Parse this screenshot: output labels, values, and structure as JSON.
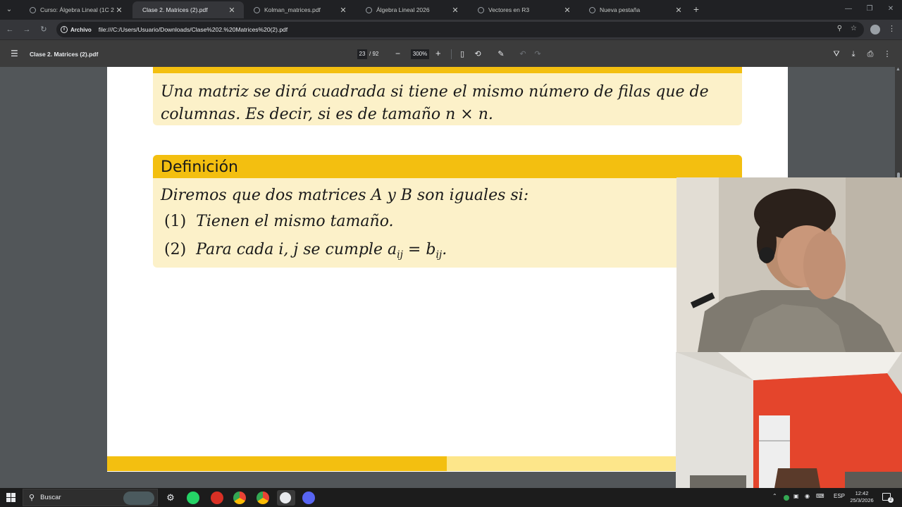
{
  "browser": {
    "tabs": [
      {
        "title": "Curso: Álgebra Lineal (1C 2026)",
        "active": false
      },
      {
        "title": "Clase 2. Matrices (2).pdf",
        "active": true
      },
      {
        "title": "Kolman_matrices.pdf",
        "active": false
      },
      {
        "title": "Álgebra Lineal 2026",
        "active": false
      },
      {
        "title": "Vectores en R3",
        "active": false
      },
      {
        "title": "Nueva pestaña",
        "active": false
      }
    ],
    "address_chip": "Archivo",
    "url": "file:///C:/Users/Usuario/Downloads/Clase%202.%20Matrices%20(2).pdf"
  },
  "pdf_toolbar": {
    "title": "Clase 2. Matrices (2).pdf",
    "page_current": "23",
    "page_total": "/ 92",
    "zoom": "300%"
  },
  "document": {
    "block1": {
      "line1": "Una matriz se dirá cuadrada si tiene el mismo número de filas que de",
      "line2": "columnas. Es decir, si es de tamaño n × n."
    },
    "definition": {
      "heading": "Definición",
      "intro": "Diremos que dos matrices A y B son iguales si:",
      "item1_num": "(1)",
      "item1_text": "Tienen el mismo tamaño.",
      "item2_num": "(2)",
      "item2_pre": "Para cada i, j se cumple a",
      "item2_sub1": "ij",
      "item2_mid": " = b",
      "item2_sub2": "ij",
      "item2_end": "."
    }
  },
  "taskbar": {
    "search_placeholder": "Buscar",
    "language": "ESP",
    "time": "12:42",
    "date": "25/3/2026",
    "notification_count": "2"
  },
  "colors": {
    "accent_yellow": "#f3bf10",
    "block_bg": "#fcf1c9"
  }
}
